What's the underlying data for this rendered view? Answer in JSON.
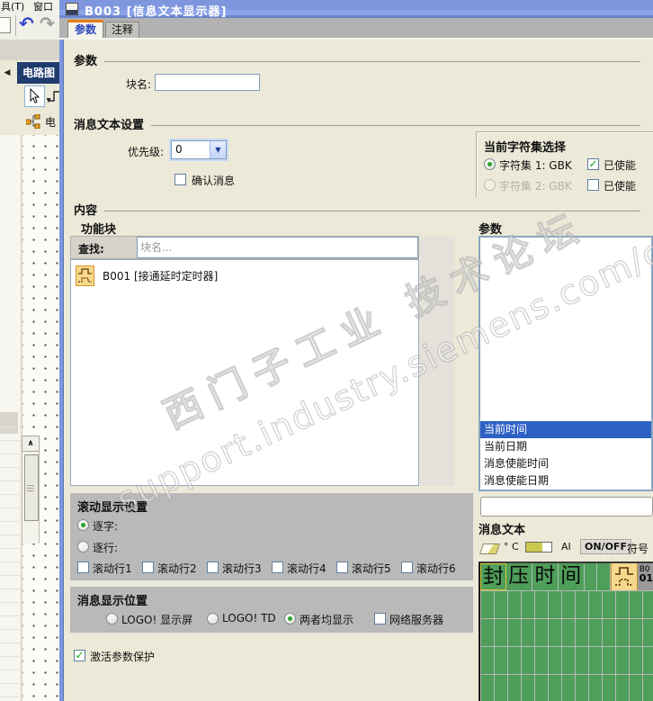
{
  "background": {
    "menu_item_tools": "具(T)",
    "menu_item_window": "窗口",
    "panel_title": "电路图",
    "tree_label": "电",
    "scroll_up_glyph": "∧",
    "undo_glyph": "↶",
    "redo_glyph": "↷",
    "collapse_glyph": "◀"
  },
  "titlebar": {
    "title": "B003  [信息文本显示器]"
  },
  "tabs": {
    "params": "参数",
    "comments": "注释"
  },
  "params_section": {
    "title": "参数",
    "block_name_label": "块名:"
  },
  "msg_settings": {
    "title": "消息文本设置",
    "priority_label": "优先级:",
    "priority_value": "0",
    "ack_label": "确认消息"
  },
  "charset": {
    "title": "当前字符集选择",
    "set1_label": "字符集 1: GBK",
    "set1_enabled_label": "已使能",
    "set2_label": "字符集 2: GBK",
    "set2_enabled_label": "已使能"
  },
  "content": {
    "title": "内容",
    "function_blocks_title": "功能块",
    "find_label": "查找:",
    "find_placeholder": "块名...",
    "block_item_label": "B001 [接通延时定时器]",
    "params_list_title": "参数",
    "param_items": [
      "当前时间",
      "当前日期",
      "消息使能时间",
      "消息使能日期"
    ]
  },
  "scroll_settings": {
    "title": "滚动显示设置",
    "by_char_label": "逐字:",
    "by_line_label": "逐行:",
    "lines": [
      "滚动行1",
      "滚动行2",
      "滚动行3",
      "滚动行4",
      "滚动行5",
      "滚动行6"
    ]
  },
  "display_position": {
    "title": "消息显示位置",
    "opt_display": "LOGO! 显示屏",
    "opt_td": "LOGO! TD",
    "opt_both": "两者均显示",
    "web_server_label": "网络服务器"
  },
  "protection": {
    "label": "激活参数保护"
  },
  "message_text": {
    "title": "消息文本",
    "degc_label": "° C",
    "ai_label": "AI",
    "onoff_label": "ON/OFF",
    "symbol_label": "符号",
    "cells": [
      "封",
      "压",
      "时",
      "间"
    ],
    "block_ref_line1": "B0",
    "block_ref_line2": "01"
  },
  "watermark": {
    "line1": "西门子工业 技术论坛",
    "line2": "support.industry.siemens.com/cs"
  },
  "colors": {
    "titlebar_blue": "#7e95dd",
    "selection_blue": "#2e61c4",
    "grid_green": "#4f9e5a",
    "accent_orange": "#e87d17",
    "panel_gray": "#b9b9b9",
    "check_green": "#18a018"
  }
}
